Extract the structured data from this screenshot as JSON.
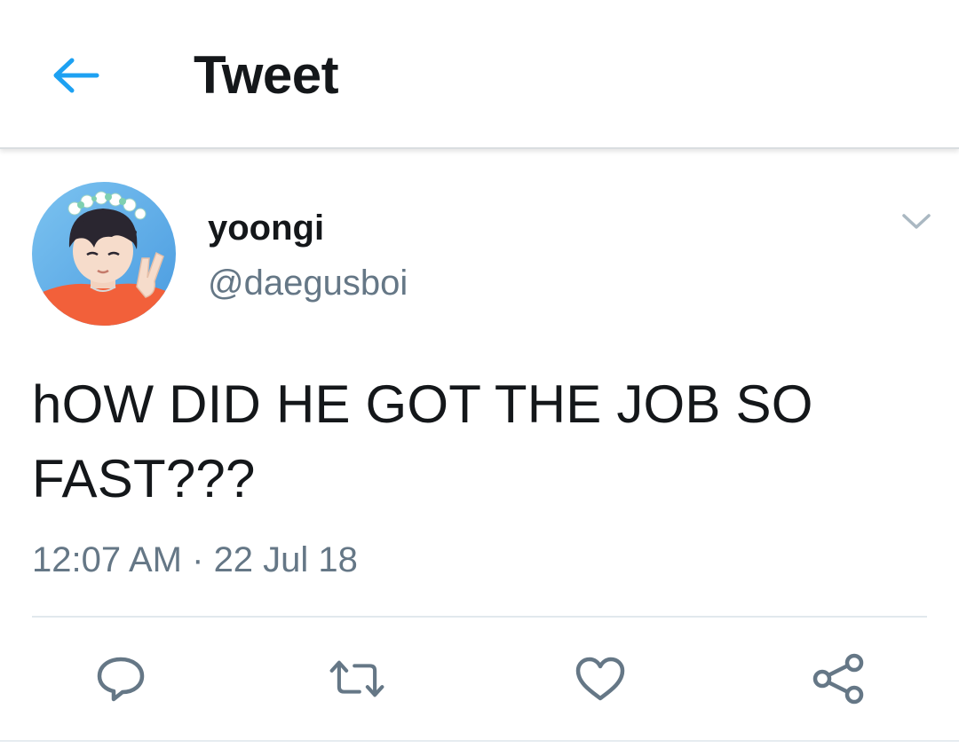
{
  "header": {
    "title": "Tweet",
    "back_icon": "arrow-left-icon",
    "accent_color": "#1da1f2"
  },
  "tweet": {
    "author": {
      "display_name": "yoongi",
      "handle": "@daegusboi",
      "avatar_icon": "profile-photo"
    },
    "text_line1": "hOW DID HE GOT THE JOB SO",
    "text_line2": "FAST???",
    "time": "12:07 AM",
    "separator": " · ",
    "date": "22 Jul 18",
    "menu_icon": "chevron-down-icon"
  },
  "actions": [
    {
      "name": "reply",
      "icon": "reply-icon"
    },
    {
      "name": "retweet",
      "icon": "retweet-icon"
    },
    {
      "name": "like",
      "icon": "heart-icon"
    },
    {
      "name": "share",
      "icon": "share-icon"
    }
  ],
  "colors": {
    "text": "#14171a",
    "secondary": "#657786",
    "icon_gray": "#657786",
    "divider": "#e1e8ed"
  }
}
